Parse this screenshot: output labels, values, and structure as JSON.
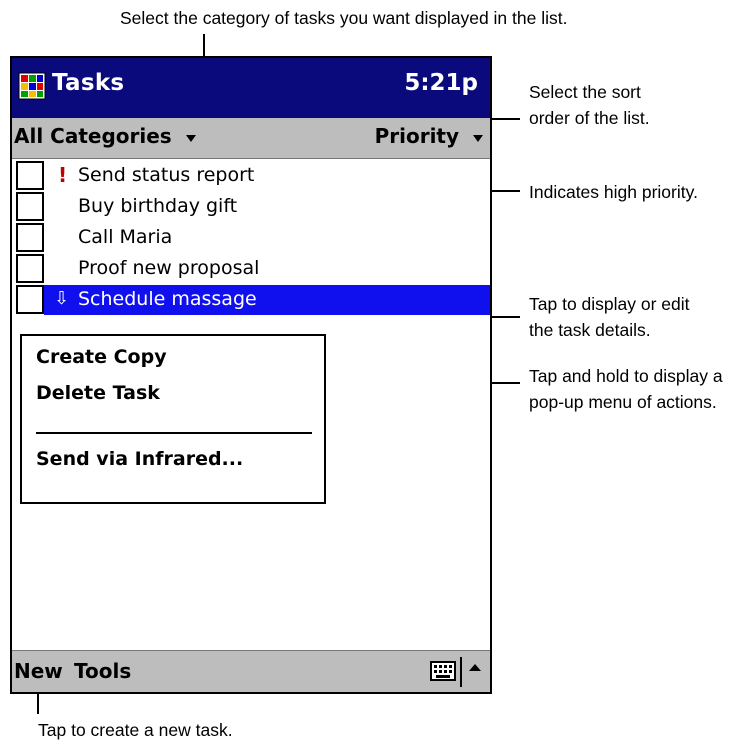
{
  "annotations": {
    "top": "Select the category of tasks you want displayed in the list.",
    "sort_line1": "Select the sort",
    "sort_line2": "order of the list.",
    "priority": "Indicates high priority.",
    "tap_line1": "Tap to display or edit",
    "tap_line2": "the task details.",
    "hold_line1": "Tap and hold to display a",
    "hold_line2": "pop-up menu of actions.",
    "bottom": "Tap to create a new task."
  },
  "titlebar": {
    "app_name": "Tasks",
    "clock": "5:21p",
    "icon": "tasks-app-icon"
  },
  "filterbar": {
    "category": "All Categories",
    "sort": "Priority"
  },
  "tasks": [
    {
      "text": "Send status report",
      "priority_marker": "!",
      "priority": "high",
      "selected": false
    },
    {
      "text": "Buy birthday gift",
      "priority_marker": "",
      "priority": "normal",
      "selected": false
    },
    {
      "text": "Call Maria",
      "priority_marker": "",
      "priority": "normal",
      "selected": false
    },
    {
      "text": "Proof new proposal",
      "priority_marker": "",
      "priority": "normal",
      "selected": false
    },
    {
      "text": "Schedule massage",
      "priority_marker": "⇩",
      "priority": "low",
      "selected": true
    }
  ],
  "context_menu": {
    "items": [
      "Create Copy",
      "Delete Task",
      "Send via Infrared..."
    ]
  },
  "bottombar": {
    "new_label": "New",
    "tools_label": "Tools",
    "keyboard_icon": "keyboard-icon",
    "arrow_icon": "up-arrow-icon"
  },
  "colors": {
    "titlebar": "#0a0a7c",
    "selection": "#1010ee",
    "bars": "#bdbdbd",
    "high_priority": "#c00000"
  }
}
